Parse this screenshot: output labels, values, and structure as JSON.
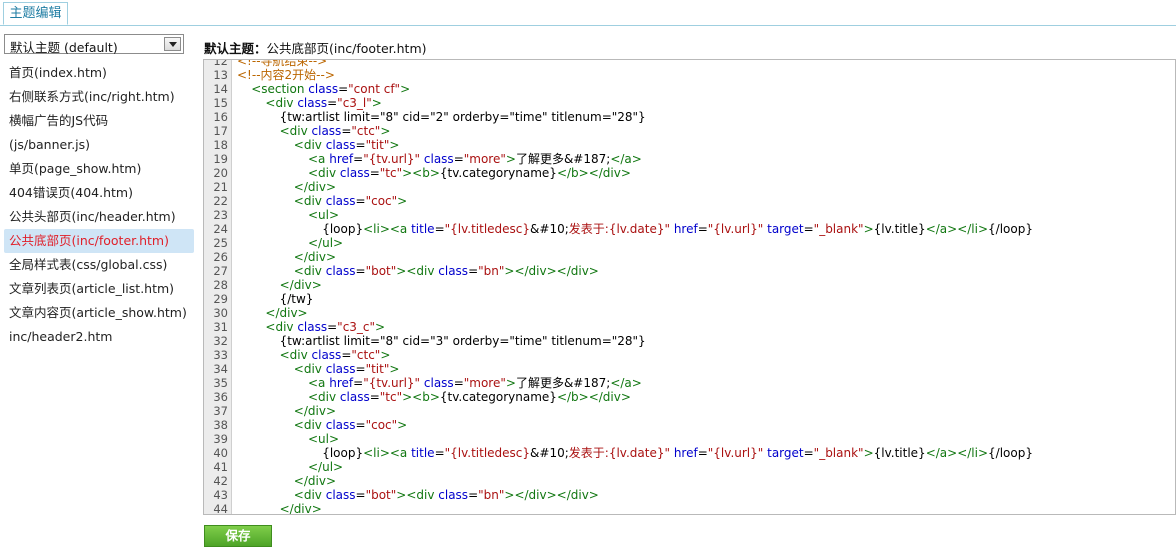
{
  "tab": {
    "label": "主题编辑"
  },
  "theme_select": {
    "value": "默认主题 (default)"
  },
  "files": [
    "首页(index.htm)",
    "右侧联系方式(inc/right.htm)",
    "横幅广告的JS代码",
    "(js/banner.js)",
    "单页(page_show.htm)",
    "404错误页(404.htm)",
    "公共头部页(inc/header.htm)",
    "公共底部页(inc/footer.htm)",
    "全局样式表(css/global.css)",
    "文章列表页(article_list.htm)",
    "文章内容页(article_show.htm)",
    "inc/header2.htm"
  ],
  "active_file_index": 7,
  "editor": {
    "title_label": "默认主题：",
    "title_file": "公共底部页(inc/footer.htm)",
    "lines": [
      {
        "n": "12",
        "i": 0,
        "t": [
          [
            "cm",
            "<!--导航结束-->"
          ]
        ]
      },
      {
        "n": "13",
        "i": 0,
        "t": [
          [
            "cm",
            "<!--内容2开始-->"
          ]
        ]
      },
      {
        "n": "14",
        "i": 2,
        "t": [
          [
            "tg",
            "<section "
          ],
          [
            "at",
            "class"
          ],
          [
            "tx",
            "="
          ],
          [
            "av",
            "\"cont cf\""
          ],
          [
            "tg",
            ">"
          ]
        ]
      },
      {
        "n": "15",
        "i": 4,
        "t": [
          [
            "tg",
            "<div "
          ],
          [
            "at",
            "class"
          ],
          [
            "tx",
            "="
          ],
          [
            "av",
            "\"c3_l\""
          ],
          [
            "tg",
            ">"
          ]
        ]
      },
      {
        "n": "16",
        "i": 6,
        "t": [
          [
            "tx",
            "{tw:artlist limit=\"8\" cid=\"2\" orderby=\"time\" titlenum=\"28\"}"
          ]
        ]
      },
      {
        "n": "17",
        "i": 6,
        "t": [
          [
            "tg",
            "<div "
          ],
          [
            "at",
            "class"
          ],
          [
            "tx",
            "="
          ],
          [
            "av",
            "\"ctc\""
          ],
          [
            "tg",
            ">"
          ]
        ]
      },
      {
        "n": "18",
        "i": 8,
        "t": [
          [
            "tg",
            "<div "
          ],
          [
            "at",
            "class"
          ],
          [
            "tx",
            "="
          ],
          [
            "av",
            "\"tit\""
          ],
          [
            "tg",
            ">"
          ]
        ]
      },
      {
        "n": "19",
        "i": 10,
        "t": [
          [
            "tg",
            "<a "
          ],
          [
            "at",
            "href"
          ],
          [
            "tx",
            "="
          ],
          [
            "av",
            "\"{tv.url}\""
          ],
          [
            "tx",
            " "
          ],
          [
            "at",
            "class"
          ],
          [
            "tx",
            "="
          ],
          [
            "av",
            "\"more\""
          ],
          [
            "tg",
            ">"
          ],
          [
            "tx",
            "了解更多&#187;"
          ],
          [
            "tg",
            "</a>"
          ]
        ]
      },
      {
        "n": "20",
        "i": 10,
        "t": [
          [
            "tg",
            "<div "
          ],
          [
            "at",
            "class"
          ],
          [
            "tx",
            "="
          ],
          [
            "av",
            "\"tc\""
          ],
          [
            "tg",
            "><b>"
          ],
          [
            "tx",
            "{tv.categoryname}"
          ],
          [
            "tg",
            "</b></div>"
          ]
        ]
      },
      {
        "n": "21",
        "i": 8,
        "t": [
          [
            "tg",
            "</div>"
          ]
        ]
      },
      {
        "n": "22",
        "i": 8,
        "t": [
          [
            "tg",
            "<div "
          ],
          [
            "at",
            "class"
          ],
          [
            "tx",
            "="
          ],
          [
            "av",
            "\"coc\""
          ],
          [
            "tg",
            ">"
          ]
        ]
      },
      {
        "n": "23",
        "i": 10,
        "t": [
          [
            "tg",
            "<ul>"
          ]
        ]
      },
      {
        "n": "24",
        "i": 12,
        "t": [
          [
            "tx",
            "{loop}"
          ],
          [
            "tg",
            "<li><a "
          ],
          [
            "at",
            "title"
          ],
          [
            "tx",
            "="
          ],
          [
            "av",
            "\"{lv.titledesc}"
          ],
          [
            "tx",
            "&#10;"
          ],
          [
            "av",
            "发表于:{lv.date}\""
          ],
          [
            "tx",
            " "
          ],
          [
            "at",
            "href"
          ],
          [
            "tx",
            "="
          ],
          [
            "av",
            "\"{lv.url}\""
          ],
          [
            "tx",
            " "
          ],
          [
            "at",
            "target"
          ],
          [
            "tx",
            "="
          ],
          [
            "av",
            "\"_blank\""
          ],
          [
            "tg",
            ">"
          ],
          [
            "tx",
            "{lv.title}"
          ],
          [
            "tg",
            "</a></li>"
          ],
          [
            "tx",
            "{/loop}"
          ]
        ]
      },
      {
        "n": "25",
        "i": 10,
        "t": [
          [
            "tg",
            "</ul>"
          ]
        ]
      },
      {
        "n": "26",
        "i": 8,
        "t": [
          [
            "tg",
            "</div>"
          ]
        ]
      },
      {
        "n": "27",
        "i": 8,
        "t": [
          [
            "tg",
            "<div "
          ],
          [
            "at",
            "class"
          ],
          [
            "tx",
            "="
          ],
          [
            "av",
            "\"bot\""
          ],
          [
            "tg",
            "><div "
          ],
          [
            "at",
            "class"
          ],
          [
            "tx",
            "="
          ],
          [
            "av",
            "\"bn\""
          ],
          [
            "tg",
            "></div></div>"
          ]
        ]
      },
      {
        "n": "28",
        "i": 6,
        "t": [
          [
            "tg",
            "</div>"
          ]
        ]
      },
      {
        "n": "29",
        "i": 6,
        "t": [
          [
            "tx",
            "{/tw}"
          ]
        ]
      },
      {
        "n": "30",
        "i": 4,
        "t": [
          [
            "tg",
            "</div>"
          ]
        ]
      },
      {
        "n": "31",
        "i": 4,
        "t": [
          [
            "tg",
            "<div "
          ],
          [
            "at",
            "class"
          ],
          [
            "tx",
            "="
          ],
          [
            "av",
            "\"c3_c\""
          ],
          [
            "tg",
            ">"
          ]
        ]
      },
      {
        "n": "32",
        "i": 6,
        "t": [
          [
            "tx",
            "{tw:artlist limit=\"8\" cid=\"3\" orderby=\"time\" titlenum=\"28\"}"
          ]
        ]
      },
      {
        "n": "33",
        "i": 6,
        "t": [
          [
            "tg",
            "<div "
          ],
          [
            "at",
            "class"
          ],
          [
            "tx",
            "="
          ],
          [
            "av",
            "\"ctc\""
          ],
          [
            "tg",
            ">"
          ]
        ]
      },
      {
        "n": "34",
        "i": 8,
        "t": [
          [
            "tg",
            "<div "
          ],
          [
            "at",
            "class"
          ],
          [
            "tx",
            "="
          ],
          [
            "av",
            "\"tit\""
          ],
          [
            "tg",
            ">"
          ]
        ]
      },
      {
        "n": "35",
        "i": 10,
        "t": [
          [
            "tg",
            "<a "
          ],
          [
            "at",
            "href"
          ],
          [
            "tx",
            "="
          ],
          [
            "av",
            "\"{tv.url}\""
          ],
          [
            "tx",
            " "
          ],
          [
            "at",
            "class"
          ],
          [
            "tx",
            "="
          ],
          [
            "av",
            "\"more\""
          ],
          [
            "tg",
            ">"
          ],
          [
            "tx",
            "了解更多&#187;"
          ],
          [
            "tg",
            "</a>"
          ]
        ]
      },
      {
        "n": "36",
        "i": 10,
        "t": [
          [
            "tg",
            "<div "
          ],
          [
            "at",
            "class"
          ],
          [
            "tx",
            "="
          ],
          [
            "av",
            "\"tc\""
          ],
          [
            "tg",
            "><b>"
          ],
          [
            "tx",
            "{tv.categoryname}"
          ],
          [
            "tg",
            "</b></div>"
          ]
        ]
      },
      {
        "n": "37",
        "i": 8,
        "t": [
          [
            "tg",
            "</div>"
          ]
        ]
      },
      {
        "n": "38",
        "i": 8,
        "t": [
          [
            "tg",
            "<div "
          ],
          [
            "at",
            "class"
          ],
          [
            "tx",
            "="
          ],
          [
            "av",
            "\"coc\""
          ],
          [
            "tg",
            ">"
          ]
        ]
      },
      {
        "n": "39",
        "i": 10,
        "t": [
          [
            "tg",
            "<ul>"
          ]
        ]
      },
      {
        "n": "40",
        "i": 12,
        "t": [
          [
            "tx",
            "{loop}"
          ],
          [
            "tg",
            "<li><a "
          ],
          [
            "at",
            "title"
          ],
          [
            "tx",
            "="
          ],
          [
            "av",
            "\"{lv.titledesc}"
          ],
          [
            "tx",
            "&#10;"
          ],
          [
            "av",
            "发表于:{lv.date}\""
          ],
          [
            "tx",
            " "
          ],
          [
            "at",
            "href"
          ],
          [
            "tx",
            "="
          ],
          [
            "av",
            "\"{lv.url}\""
          ],
          [
            "tx",
            " "
          ],
          [
            "at",
            "target"
          ],
          [
            "tx",
            "="
          ],
          [
            "av",
            "\"_blank\""
          ],
          [
            "tg",
            ">"
          ],
          [
            "tx",
            "{lv.title}"
          ],
          [
            "tg",
            "</a></li>"
          ],
          [
            "tx",
            "{/loop}"
          ]
        ]
      },
      {
        "n": "41",
        "i": 10,
        "t": [
          [
            "tg",
            "</ul>"
          ]
        ]
      },
      {
        "n": "42",
        "i": 8,
        "t": [
          [
            "tg",
            "</div>"
          ]
        ]
      },
      {
        "n": "43",
        "i": 8,
        "t": [
          [
            "tg",
            "<div "
          ],
          [
            "at",
            "class"
          ],
          [
            "tx",
            "="
          ],
          [
            "av",
            "\"bot\""
          ],
          [
            "tg",
            "><div "
          ],
          [
            "at",
            "class"
          ],
          [
            "tx",
            "="
          ],
          [
            "av",
            "\"bn\""
          ],
          [
            "tg",
            "></div></div>"
          ]
        ]
      },
      {
        "n": "44",
        "i": 6,
        "t": [
          [
            "tg",
            "</div>"
          ]
        ]
      }
    ]
  },
  "save_button": {
    "label": "保存"
  },
  "colors": {
    "tag": "#117711",
    "attr": "#0000cc",
    "value": "#aa1111",
    "comment": "#bb6600",
    "active_file": "#e0202a",
    "save": "#5aaf30"
  }
}
